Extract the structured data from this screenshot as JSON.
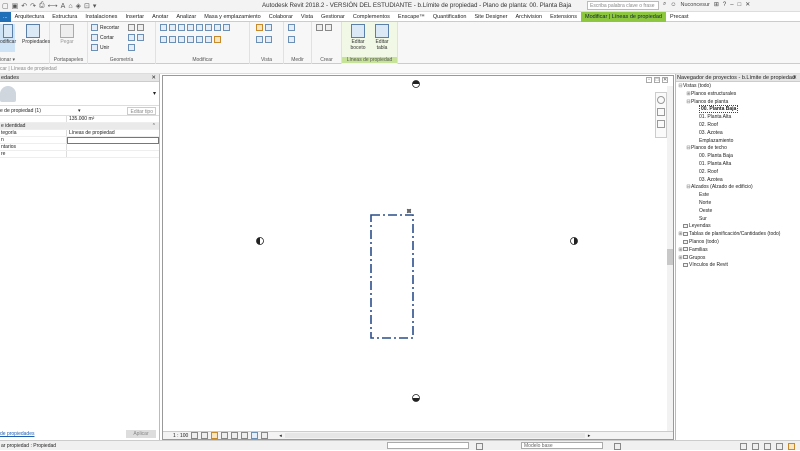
{
  "title_bar": {
    "title": "Autodesk Revit 2018.2 - VERSIÓN DEL ESTUDIANTE -  b.Límite de propiedad - Plano de planta: 00. Planta Baja",
    "search_placeholder": "Escriba palabra clave o frase",
    "user": "Nuconcesur"
  },
  "menu": {
    "file": "...",
    "tabs": [
      "Arquitectura",
      "Estructura",
      "Instalaciones",
      "Insertar",
      "Anotar",
      "Analizar",
      "Masa y emplazamiento",
      "Colaborar",
      "Vista",
      "Gestionar",
      "Complementos",
      "Enscape™",
      "Quantification",
      "Site Designer",
      "Archivision",
      "Extensions",
      "Modificar | Líneas de propiedad",
      "Precast"
    ],
    "active_tab": "Modificar | Líneas de propiedad"
  },
  "ribbon": {
    "modify": "odificar",
    "select_group": "ionar ▾",
    "properties": "Propiedades",
    "clipboard": "Portapapeles",
    "paste": "Pegar",
    "cut": "Recortar",
    "cope": "Cortar",
    "join": "Unir",
    "geometry": "Geometría",
    "modify_group": "Modificar",
    "view": "Vista",
    "measure": "Medir",
    "create": "Crear",
    "edit_sketch": "Editar boceto",
    "edit_table": "Editar tabla",
    "context_group": "Líneas de propiedad"
  },
  "options_bar": {
    "text": "car | Líneas de propiedad"
  },
  "properties": {
    "title": "edades",
    "type_selector": "e de propiedad (1)",
    "edit_type": "Editar tipo",
    "area_value": "135.000 m²",
    "section": "e identidad",
    "rows": [
      {
        "key": "tegoría",
        "value": "Líneas de propiedad"
      },
      {
        "key": "n",
        "value": ""
      },
      {
        "key": "ntarios",
        "value": ""
      },
      {
        "key": "re",
        "value": ""
      }
    ],
    "help_link": "de propiedades",
    "apply": "Aplicar"
  },
  "view": {
    "scale": "1 : 100"
  },
  "browser": {
    "title": "Navegador de proyectos - b.Límite de propiedad",
    "tree": [
      {
        "label": "Vistas (todo)",
        "level": 0,
        "toggle": "⊟"
      },
      {
        "label": "Planos estructurales",
        "level": 1,
        "toggle": "⊞"
      },
      {
        "label": "Planos de planta",
        "level": 1,
        "toggle": "⊟"
      },
      {
        "label": "00. Planta Baja",
        "level": 2,
        "toggle": "",
        "selected": true
      },
      {
        "label": "01. Planta Alta",
        "level": 2,
        "toggle": ""
      },
      {
        "label": "02. Roof",
        "level": 2,
        "toggle": ""
      },
      {
        "label": "03. Azotea",
        "level": 2,
        "toggle": ""
      },
      {
        "label": "Emplazamiento",
        "level": 2,
        "toggle": ""
      },
      {
        "label": "Planos de techo",
        "level": 1,
        "toggle": "⊟"
      },
      {
        "label": "00. Planta Baja",
        "level": 2,
        "toggle": ""
      },
      {
        "label": "01. Planta Alta",
        "level": 2,
        "toggle": ""
      },
      {
        "label": "02. Roof",
        "level": 2,
        "toggle": ""
      },
      {
        "label": "03. Azotea",
        "level": 2,
        "toggle": ""
      },
      {
        "label": "Alzados (Alzado de edificio)",
        "level": 1,
        "toggle": "⊟"
      },
      {
        "label": "Este",
        "level": 2,
        "toggle": ""
      },
      {
        "label": "Norte",
        "level": 2,
        "toggle": ""
      },
      {
        "label": "Oeste",
        "level": 2,
        "toggle": ""
      },
      {
        "label": "Sur",
        "level": 2,
        "toggle": ""
      },
      {
        "label": "Leyendas",
        "level": 0,
        "toggle": "",
        "icon": true
      },
      {
        "label": "Tablas de planificación/Cantidades (todo)",
        "level": 0,
        "toggle": "⊞",
        "icon": true
      },
      {
        "label": "Planos (todo)",
        "level": 0,
        "toggle": "",
        "icon": true
      },
      {
        "label": "Familias",
        "level": 0,
        "toggle": "⊞",
        "icon": true
      },
      {
        "label": "Grupos",
        "level": 0,
        "toggle": "⊞",
        "icon": true
      },
      {
        "label": "Vínculos de Revit",
        "level": 0,
        "toggle": "",
        "icon": true
      }
    ]
  },
  "status_bar": {
    "left": "ar propiedad : Propiedad",
    "model": "Modelo base"
  },
  "colors": {
    "accent": "#8dc63f",
    "file_tab": "#1e6fb8",
    "sketch_line": "#2b4f8c"
  }
}
